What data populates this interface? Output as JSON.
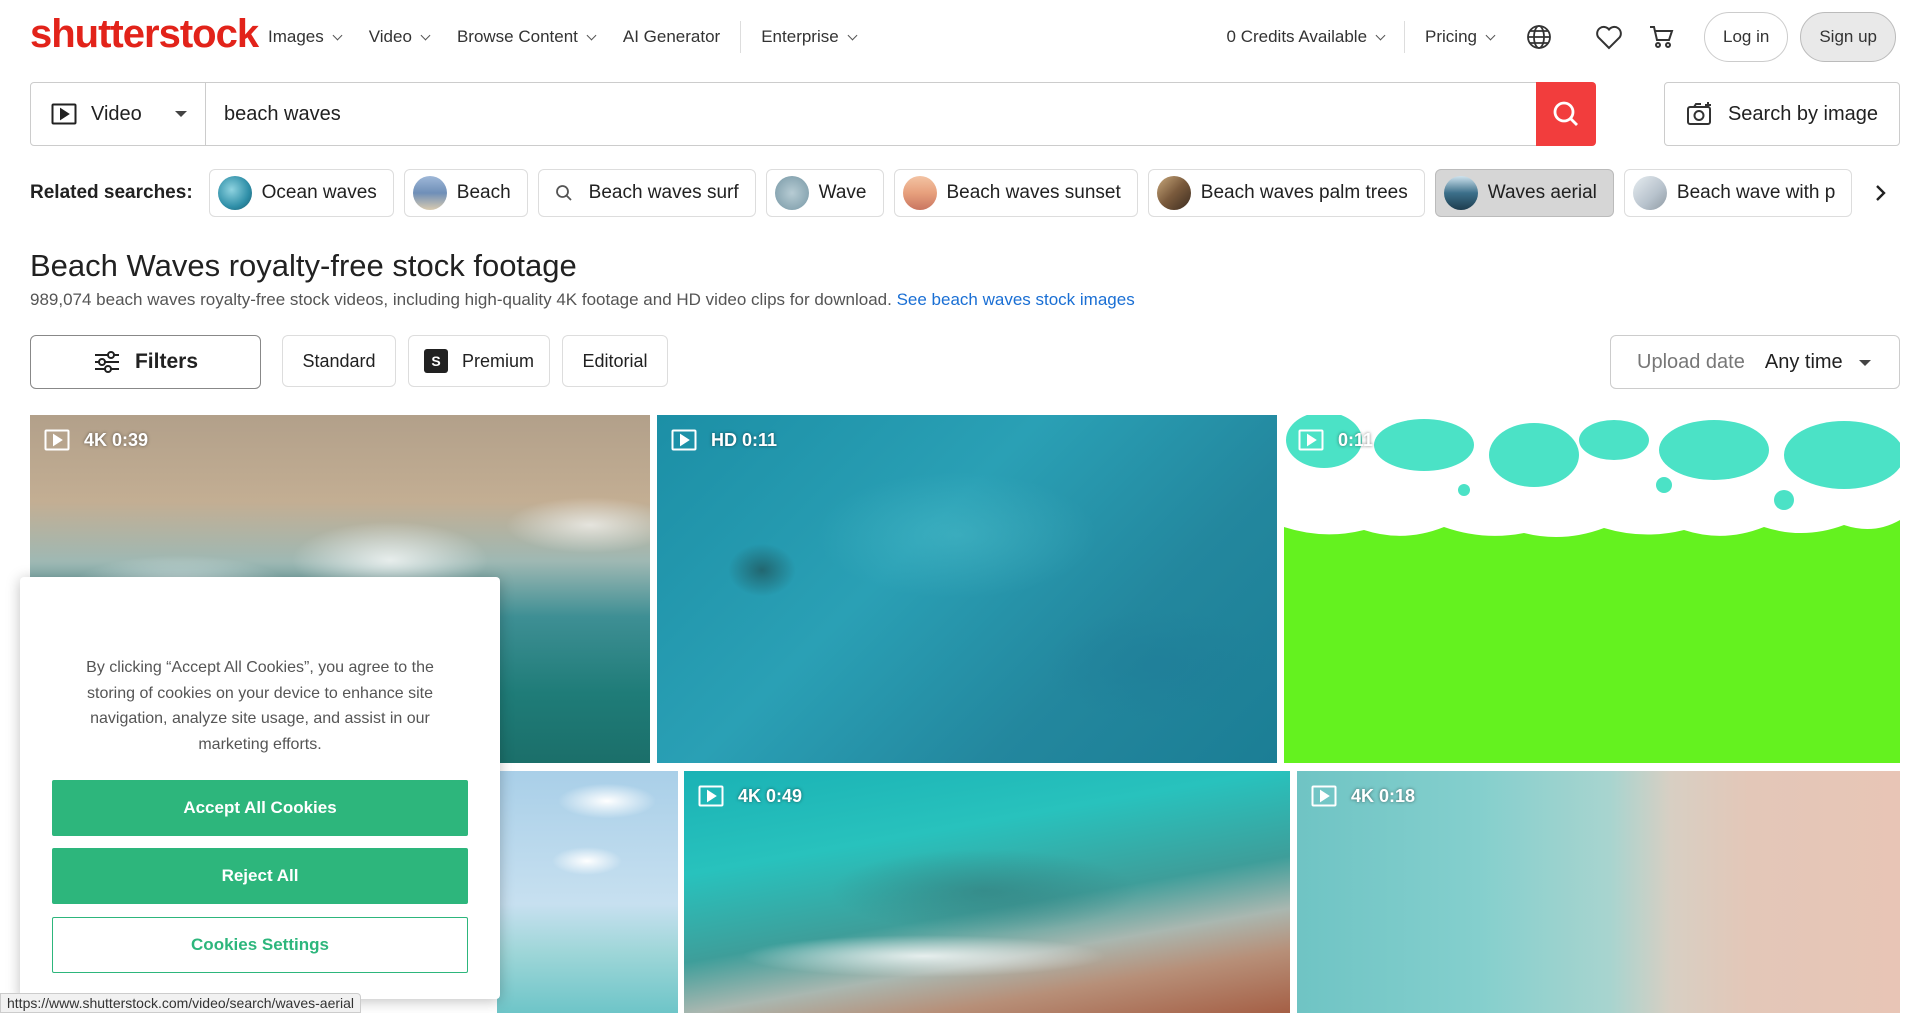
{
  "header": {
    "logo": "shutterstock",
    "nav": [
      {
        "label": "Images",
        "dropdown": true
      },
      {
        "label": "Video",
        "dropdown": true
      },
      {
        "label": "Browse Content",
        "dropdown": true
      },
      {
        "label": "AI Generator",
        "dropdown": false
      },
      {
        "label": "Enterprise",
        "dropdown": true
      }
    ],
    "credits": "0 Credits Available",
    "pricing": "Pricing",
    "login": "Log in",
    "signup": "Sign up"
  },
  "search": {
    "type": "Video",
    "query": "beach waves",
    "search_by_image": "Search by image"
  },
  "related": {
    "label": "Related searches:",
    "items": [
      {
        "label": "Ocean waves",
        "thumb_color": "#2f8fa8"
      },
      {
        "label": "Beach",
        "thumb_color": "#6f8fb8"
      },
      {
        "label": "Beach waves surf",
        "thumb_color": ""
      },
      {
        "label": "Wave",
        "thumb_color": "#8aa7b3"
      },
      {
        "label": "Beach waves sunset",
        "thumb_color": "#e7a07d"
      },
      {
        "label": "Beach waves palm trees",
        "thumb_color": "#7a5a3c"
      },
      {
        "label": "Waves aerial",
        "thumb_color": "#3c6f8a",
        "active": true
      },
      {
        "label": "Beach wave with p",
        "thumb_color": "#b7c2cc"
      }
    ]
  },
  "page": {
    "title": "Beach Waves royalty-free stock footage",
    "subtitle": "989,074 beach waves royalty-free stock videos, including high-quality 4K footage and HD video clips for download.",
    "subtitle_link": "See beach waves stock images"
  },
  "filters": {
    "filters_label": "Filters",
    "standard": "Standard",
    "premium_badge": "S",
    "premium": "Premium",
    "editorial": "Editorial",
    "upload_label": "Upload date",
    "upload_value": "Any time"
  },
  "tiles": [
    {
      "meta": "4K 0:39"
    },
    {
      "meta": "HD 0:11"
    },
    {
      "meta": "0:11"
    },
    {
      "meta": ""
    },
    {
      "meta": "4K 0:49"
    },
    {
      "meta": "4K 0:18"
    }
  ],
  "cookie": {
    "text": "By clicking “Accept All Cookies”, you agree to the storing of cookies on your device to enhance site navigation, analyze site usage, and assist in our marketing efforts.",
    "accept": "Accept All Cookies",
    "reject": "Reject All",
    "settings": "Cookies Settings"
  },
  "status_url": "https://www.shutterstock.com/video/search/waves-aerial",
  "colors": {
    "brand": "#e2231a",
    "search_button": "#f23d3d",
    "cookie_green": "#2db67c",
    "link": "#1a6fd4"
  }
}
